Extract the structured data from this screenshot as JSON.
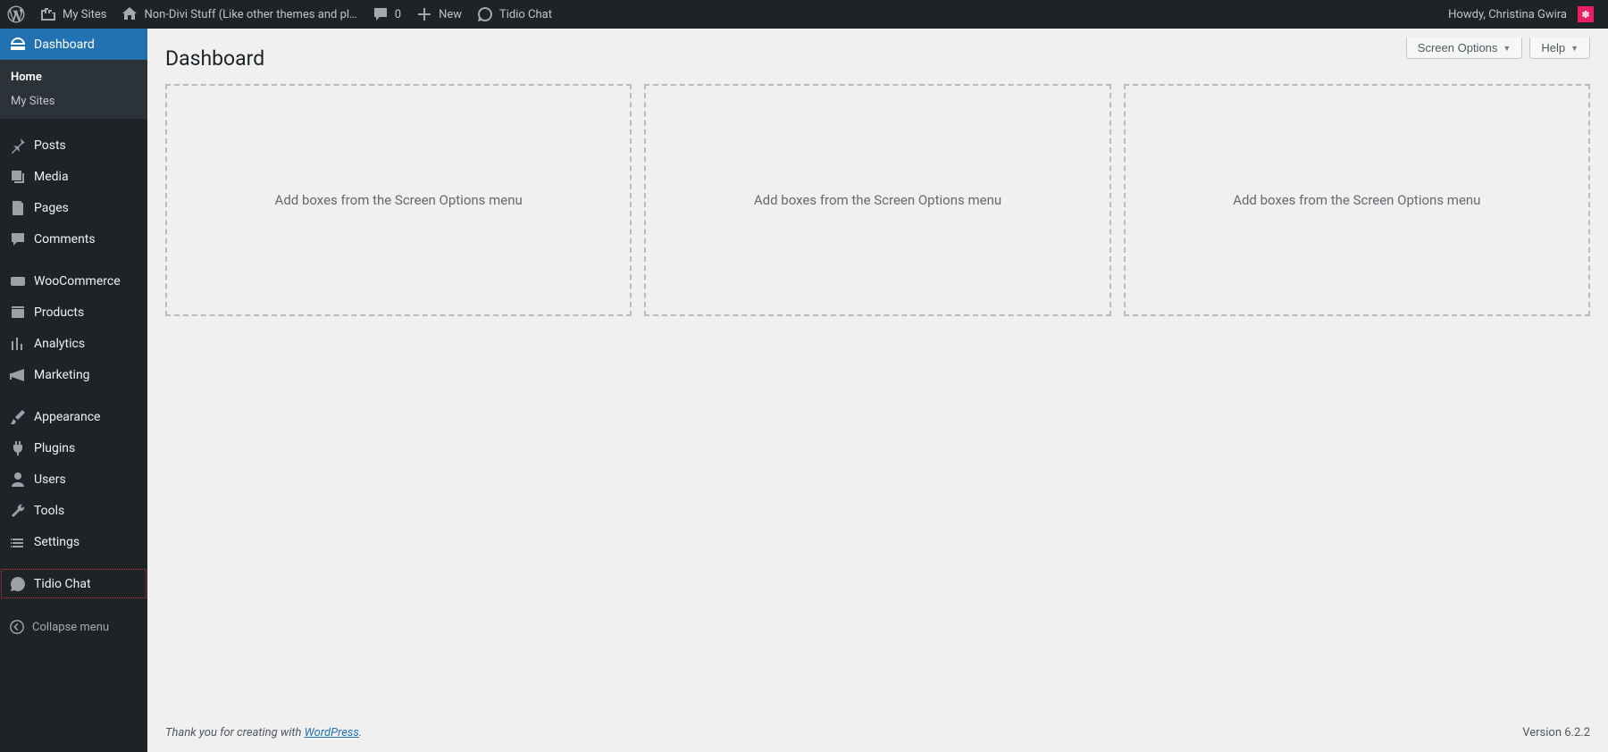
{
  "adminbar": {
    "mysites": "My Sites",
    "site_name": "Non-Divi Stuff (Like other themes and pl…",
    "comments_count": "0",
    "new_label": "New",
    "tidio_label": "Tidio Chat",
    "howdy": "Howdy, Christina Gwira"
  },
  "sidebar": {
    "dashboard": "Dashboard",
    "submenu": {
      "home": "Home",
      "mysites": "My Sites"
    },
    "posts": "Posts",
    "media": "Media",
    "pages": "Pages",
    "comments": "Comments",
    "woocommerce": "WooCommerce",
    "products": "Products",
    "analytics": "Analytics",
    "marketing": "Marketing",
    "appearance": "Appearance",
    "plugins": "Plugins",
    "users": "Users",
    "tools": "Tools",
    "settings": "Settings",
    "tidio": "Tidio Chat",
    "collapse": "Collapse menu"
  },
  "main": {
    "title": "Dashboard",
    "screen_options": "Screen Options",
    "help": "Help",
    "placeholder": "Add boxes from the Screen Options menu"
  },
  "footer": {
    "thank_prefix": "Thank you for creating with ",
    "wordpress": "WordPress",
    "version": "Version 6.2.2"
  }
}
